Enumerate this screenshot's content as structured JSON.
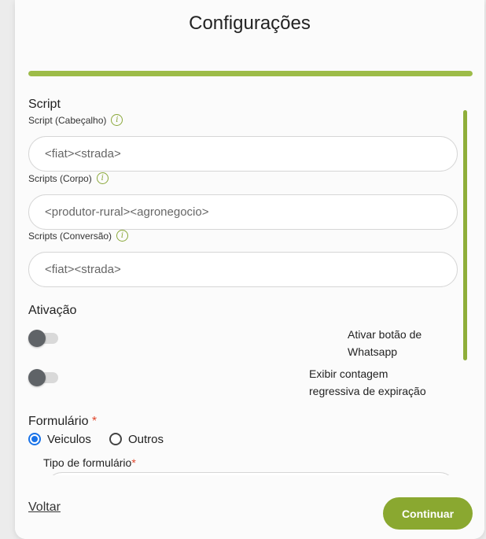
{
  "title": "Configurações",
  "progress": {
    "percent": 100,
    "color": "#9dbc48"
  },
  "script_section": {
    "title": "Script",
    "fields": [
      {
        "label": "Script (Cabeçalho)",
        "info_icon": "info-icon",
        "value": "<fiat><strada>"
      },
      {
        "label": "Scripts (Corpo)",
        "info_icon": "info-icon",
        "value": "<produtor-rural><agronegocio>"
      },
      {
        "label": "Scripts (Conversão)",
        "info_icon": "info-icon",
        "value": "<fiat><strada>"
      }
    ]
  },
  "ativacao": {
    "title": "Ativação",
    "toggles": [
      {
        "label_line1": "Ativar botão de",
        "label_line2": "Whatsapp",
        "on": false
      },
      {
        "label_line1": "Exibir contagem",
        "label_line2": "regressiva de expiração",
        "on": false
      }
    ]
  },
  "formulario": {
    "title": "Formulário",
    "required_mark": "*",
    "options": [
      {
        "label": "Veiculos",
        "selected": true
      },
      {
        "label": "Outros",
        "selected": false
      }
    ],
    "tipo_label": "Tipo de formulário",
    "tipo_required_mark": "*"
  },
  "footer": {
    "back_label": "Voltar",
    "continue_label": "Continuar"
  },
  "colors": {
    "accent": "#8aa830",
    "radio_selected": "#1a73e8",
    "required": "#e0472d"
  }
}
